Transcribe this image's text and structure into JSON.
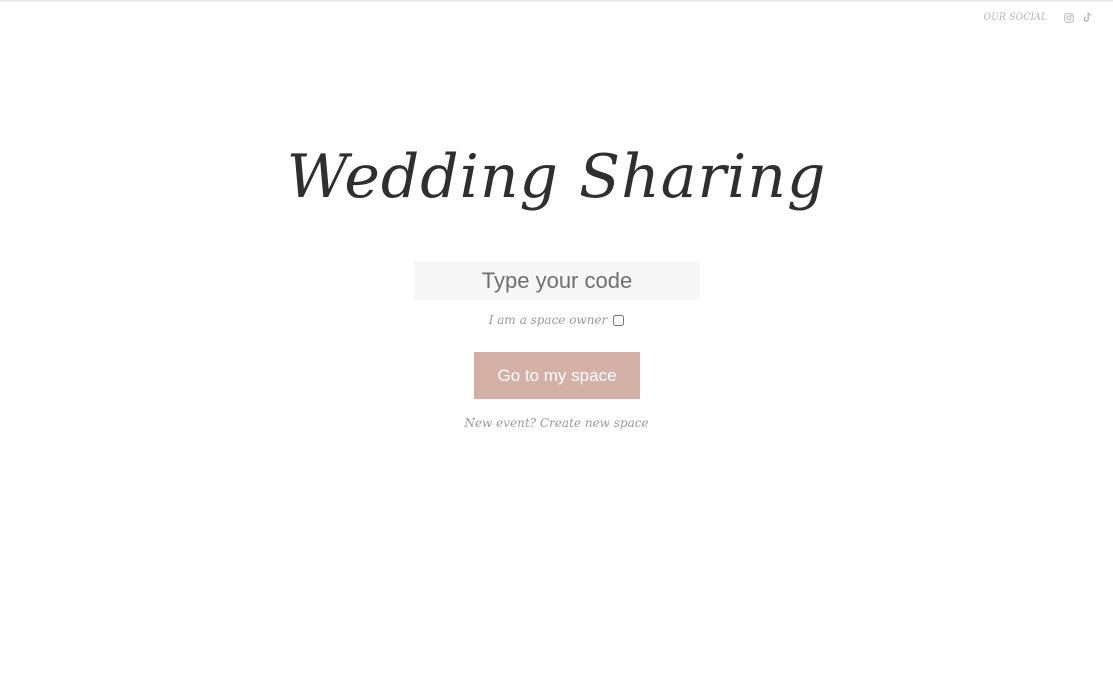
{
  "header": {
    "social_label": "OUR SOCIAL",
    "icons": [
      "instagram-icon",
      "tiktok-icon"
    ]
  },
  "main": {
    "title": "Wedding Sharing",
    "code_input": {
      "placeholder": "Type your code",
      "value": ""
    },
    "owner_checkbox_label": "I am a space owner",
    "owner_checked": false,
    "go_button_label": "Go to my space",
    "new_space_link": "New event? Create new space"
  },
  "colors": {
    "accent": "#d4b0a6",
    "title": "#2f2f2f",
    "muted": "#9a9a9a",
    "input_bg": "#f7f7f7"
  }
}
